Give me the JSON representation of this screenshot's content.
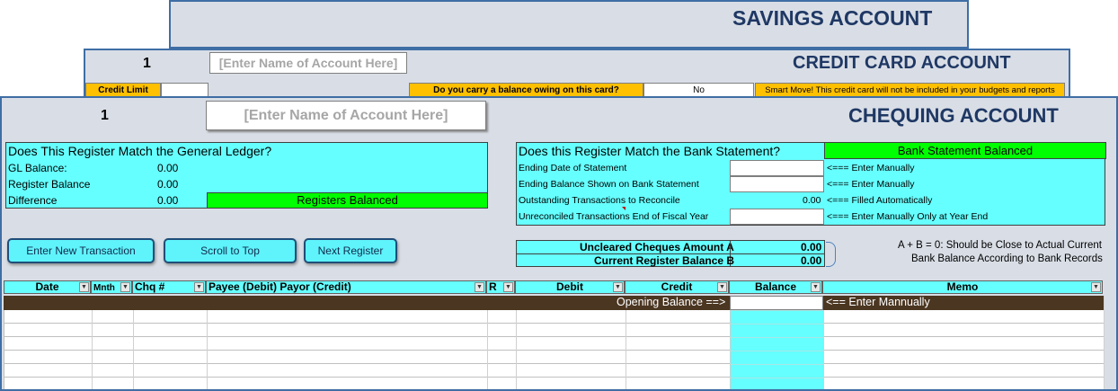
{
  "savings": {
    "title": "SAVINGS ACCOUNT"
  },
  "credit": {
    "title": "CREDIT CARD ACCOUNT",
    "number": "1",
    "name_placeholder": "[Enter Name of Account Here]",
    "credit_limit_label": "Credit Limit",
    "balance_question": "Do you carry a balance owing on this card?",
    "balance_answer": "No",
    "smart_move": "Smart Move! This credit card will not be included in your budgets and reports"
  },
  "chequing": {
    "title": "CHEQUING ACCOUNT",
    "number": "1",
    "name_placeholder": "[Enter Name of Account Here]"
  },
  "ledger": {
    "heading": "Does This Register Match the General Ledger?",
    "gl_label": "GL Balance:",
    "gl_value": "0.00",
    "register_label": "Register Balance",
    "register_value": "0.00",
    "difference_label": "Difference",
    "difference_value": "0.00",
    "status": "Registers Balanced"
  },
  "bank": {
    "heading": "Does this Register Match the Bank Statement?",
    "status": "Bank Statement Balanced",
    "rows": [
      {
        "label": "Ending Date of Statement",
        "value": "",
        "note": "<=== Enter Manually"
      },
      {
        "label": "Ending Balance Shown on Bank Statement",
        "value": "",
        "note": "<=== Enter Manually"
      },
      {
        "label": "Outstanding Transactions to Reconcile",
        "value": "0.00",
        "note": "<=== Filled Automatically"
      },
      {
        "label": "Unreconciled Transactions End of Fiscal Year",
        "value": "",
        "note": "<=== Enter Manually Only at Year End"
      }
    ]
  },
  "buttons": {
    "enter": "Enter New Transaction",
    "scroll": "Scroll to Top",
    "next": "Next Register"
  },
  "summary": {
    "a_label": "Uncleared Cheques Amount A",
    "a_value": "0.00",
    "b_label": "Current Register Balance B",
    "b_value": "0.00",
    "note_line1": "A + B = 0: Should be Close to Actual Current",
    "note_line2": "Bank Balance According to Bank Records"
  },
  "table": {
    "headers": {
      "date": "Date",
      "mnth": "Mnth",
      "chq": "Chq #",
      "payee": "Payee (Debit) Payor (Credit)",
      "r": "R",
      "debit": "Debit",
      "credit": "Credit",
      "balance": "Balance",
      "memo": "Memo"
    },
    "opening_label": "Opening Balance ==>",
    "opening_note": "<== Enter Mannually"
  },
  "colors": {
    "accent_cyan": "#66ffff",
    "balanced_green": "#00ff00",
    "title_navy": "#1f3864",
    "warning_orange": "#ffc000",
    "opening_row_brown": "#4b3621"
  }
}
